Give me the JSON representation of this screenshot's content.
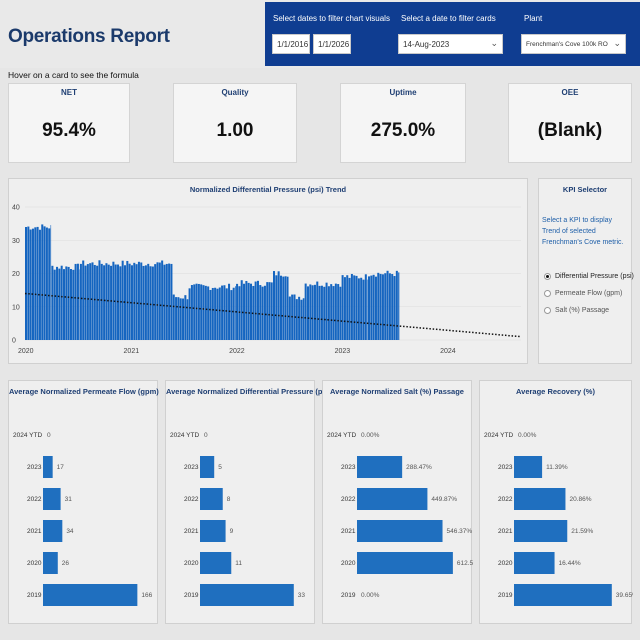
{
  "header": {
    "title": "Operations Report",
    "hover_note": "Hover on a card to see the formula"
  },
  "filters": {
    "chart_dates_label": "Select dates to filter chart visuals",
    "start_date": "1/1/2016",
    "end_date": "1/1/2026",
    "card_date_label": "Select a date to filter cards",
    "card_date": "14-Aug-2023",
    "plant_label": "Plant",
    "plant_value": "Frenchman's Cove 100k RO"
  },
  "cards": [
    {
      "title": "NET",
      "value": "95.4%"
    },
    {
      "title": "Quality",
      "value": "1.00"
    },
    {
      "title": "Uptime",
      "value": "275.0%"
    },
    {
      "title": "OEE",
      "value": "(Blank)"
    }
  ],
  "kpi_selector": {
    "title": "KPI Selector",
    "description": "Select a KPI to display Trend of selected Frenchman's Cove metric.",
    "options": [
      {
        "label": "Differential Pressure (psi)",
        "selected": true
      },
      {
        "label": "Permeate Flow (gpm)",
        "selected": false
      },
      {
        "label": "Salt (%) Passage",
        "selected": false
      }
    ]
  },
  "colors": {
    "bar": "#1f6fbf",
    "trend_bar": "#1565c0",
    "header_band": "#0f3d91",
    "title": "#1b3a6b"
  },
  "chart_data": [
    {
      "type": "bar",
      "title": "Normalized Differential Pressure (psi) Trend",
      "x_ticks": [
        "2020",
        "2021",
        "2022",
        "2023",
        "2024"
      ],
      "y_ticks": [
        "0",
        "10",
        "20",
        "30",
        "40"
      ],
      "ylim": [
        0,
        40
      ],
      "xlim": [
        2020.0,
        2024.7
      ],
      "series": [
        {
          "type": "bar",
          "segments": [
            {
              "from": 2020.0,
              "to": 2020.25,
              "value": 34
            },
            {
              "from": 2020.25,
              "to": 2020.52,
              "value": 22
            },
            {
              "from": 2020.52,
              "to": 2021.4,
              "value": 23
            },
            {
              "from": 2021.4,
              "to": 2021.55,
              "value": 13
            },
            {
              "from": 2021.55,
              "to": 2022.0,
              "value": 16
            },
            {
              "from": 2022.0,
              "to": 2022.35,
              "value": 17
            },
            {
              "from": 2022.35,
              "to": 2022.5,
              "value": 20
            },
            {
              "from": 2022.5,
              "to": 2022.65,
              "value": 13
            },
            {
              "from": 2022.65,
              "to": 2023.0,
              "value": 17
            },
            {
              "from": 2023.0,
              "to": 2023.25,
              "value": 19
            },
            {
              "from": 2023.25,
              "to": 2023.55,
              "value": 20
            }
          ]
        },
        {
          "type": "line",
          "style": "dotted",
          "x": [
            2020.0,
            2024.7
          ],
          "y": [
            14,
            1
          ]
        }
      ]
    },
    {
      "type": "bar",
      "orientation": "horizontal",
      "title": "Average Normalized Permeate Flow (gpm)",
      "categories": [
        "2024 YTD",
        "2023",
        "2022",
        "2021",
        "2020",
        "2019"
      ],
      "values": [
        0,
        17,
        31,
        34,
        26,
        166
      ],
      "labels": [
        "0",
        "17",
        "31",
        "34",
        "26",
        "166"
      ],
      "xmax": 190
    },
    {
      "type": "bar",
      "orientation": "horizontal",
      "title": "Average Normalized Differential Pressure (psi)",
      "categories": [
        "2024 YTD",
        "2023",
        "2022",
        "2021",
        "2020",
        "2019"
      ],
      "values": [
        0,
        5,
        8,
        9,
        11,
        33
      ],
      "labels": [
        "0",
        "5",
        "8",
        "9",
        "11",
        "33"
      ],
      "xmax": 38
    },
    {
      "type": "bar",
      "orientation": "horizontal",
      "title": "Average Normalized Salt (%) Passage",
      "categories": [
        "2024 YTD",
        "2023",
        "2022",
        "2021",
        "2020",
        "2019"
      ],
      "values": [
        0,
        288.47,
        449.87,
        546.37,
        612.55,
        0
      ],
      "labels": [
        "0.00%",
        "288.47%",
        "449.87%",
        "546.37%",
        "612.55%",
        "0.00%"
      ],
      "xmax": 690
    },
    {
      "type": "bar",
      "orientation": "horizontal",
      "title": "Average Recovery (%)",
      "categories": [
        "2024 YTD",
        "2023",
        "2022",
        "2021",
        "2020",
        "2019"
      ],
      "values": [
        0,
        11.39,
        20.86,
        21.59,
        16.44,
        39.65
      ],
      "labels": [
        "0.00%",
        "11.39%",
        "20.86%",
        "21.59%",
        "16.44%",
        "39.65%"
      ],
      "xmax": 45
    }
  ]
}
